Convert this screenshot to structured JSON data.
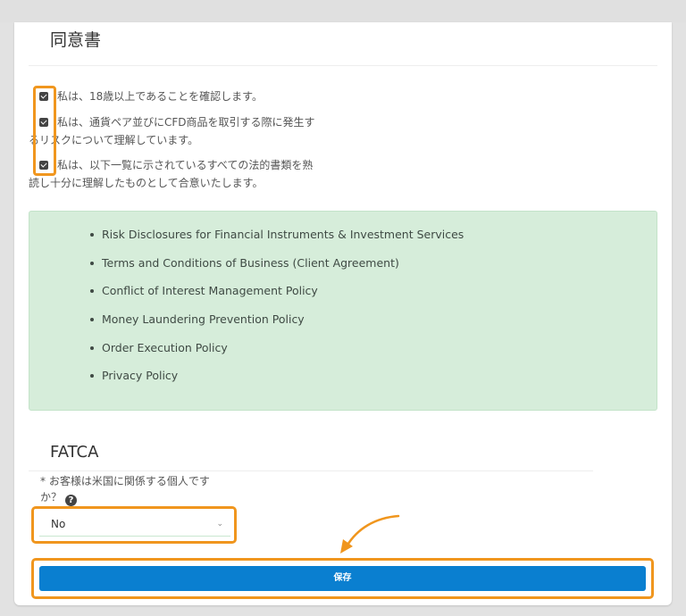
{
  "consent": {
    "title": "同意書",
    "checks": [
      {
        "line1": "私は、18歳以上であることを確認します。",
        "line2": "",
        "checked": true
      },
      {
        "line1": "私は、通貨ペア並びにCFD商品を取引する際に発生す",
        "line2": "るリスクについて理解しています。",
        "checked": true
      },
      {
        "line1": "私は、以下一覧に示されているすべての法的書類を熟",
        "line2": "読し十分に理解したものとして合意いたします。",
        "checked": true
      }
    ],
    "documents": [
      "Risk Disclosures for Financial Instruments & Investment Services",
      "Terms and Conditions of Business (Client Agreement)",
      "Conflict of Interest Management Policy",
      "Money Laundering Prevention Policy",
      "Order Execution Policy",
      "Privacy Policy"
    ]
  },
  "fatca": {
    "title": "FATCA",
    "question_line1": "* お客様は米国に関係する個人です",
    "question_line2": "か？",
    "help_icon": "?",
    "selected": "No"
  },
  "actions": {
    "save_label": "保存"
  },
  "colors": {
    "highlight": "#f0961e",
    "button": "#0a7fd0",
    "green_box": "#d6edda"
  }
}
